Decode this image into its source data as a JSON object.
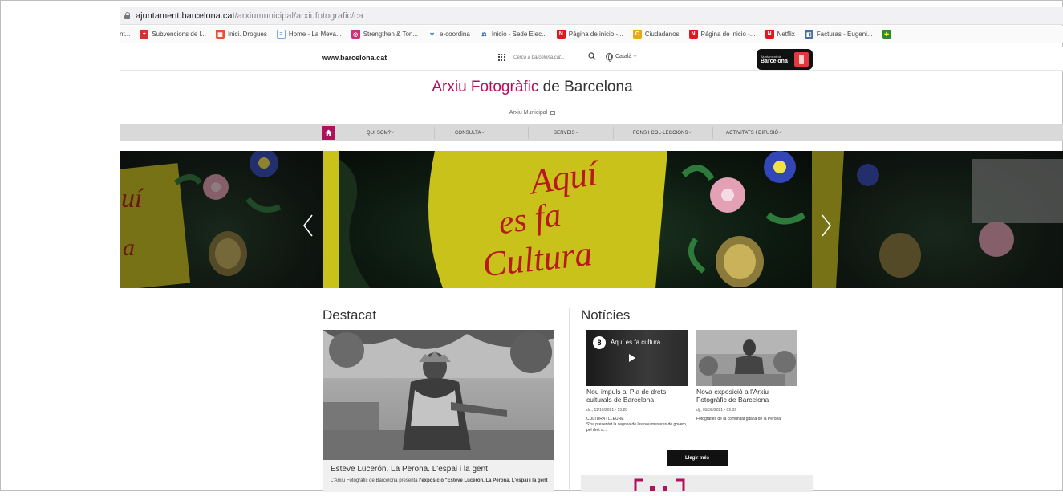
{
  "browser": {
    "url_host": "ajuntament.barcelona.cat",
    "url_path": "/arxiumunicipal/arxiufotografic/ca",
    "bookmarks": [
      {
        "label": "nt...",
        "color": ""
      },
      {
        "label": "Subvencions de l...",
        "color": "#d83030"
      },
      {
        "label": "Inici. Drogues",
        "color": "#e85030"
      },
      {
        "label": "Home - La Meva...",
        "color": "#7aa8d8"
      },
      {
        "label": "Strengthen & Ton...",
        "color": "#c8327a"
      },
      {
        "label": "e-coordina",
        "color": "#2e7bd0"
      },
      {
        "label": "Inicio - Sede Elec...",
        "color": "#1a5aa8"
      },
      {
        "label": "Página de inicio -...",
        "color": "#e0181e"
      },
      {
        "label": "Ciudadanos",
        "color": "#e6a817"
      },
      {
        "label": "Página de inicio -...",
        "color": "#e0181e"
      },
      {
        "label": "Netflix",
        "color": "#e0181e"
      },
      {
        "label": "Facturas - Eugeni...",
        "color": "#4a6fa5"
      }
    ]
  },
  "site": {
    "bcn_link": "www.barcelona.cat",
    "search_placeholder": "Cerca a barcelona.cat...",
    "language": "Català",
    "logo_small": "Ajuntament de",
    "logo_main": "Barcelona",
    "title_accent": "Arxiu Fotogràfic",
    "title_rest": " de Barcelona",
    "subtitle": "Arxiu Municipal"
  },
  "nav": {
    "items": [
      {
        "label": "QUI SOM?"
      },
      {
        "label": "CONSULTA"
      },
      {
        "label": "SERVEIS"
      },
      {
        "label": "FONS I COL·LECCIONS"
      },
      {
        "label": "ACTIVITATS I DIFUSIÓ"
      }
    ]
  },
  "hero": {
    "text_lines": [
      "Aquí",
      "es fa",
      "Cultura"
    ]
  },
  "destacat": {
    "title": "Destacat",
    "caption": "Esteve Lucerón. La Perona. L'espai i la gent",
    "text_prefix": "L'Arxiu Fotogràfic de Barcelona presenta ",
    "text_bold": "l'exposició \"Esteve Lucerón. La Perona. L'espai i la gent"
  },
  "noticies": {
    "title": "Notícies",
    "items": [
      {
        "video_title": "Aquí es fa cultura...",
        "title": "Nou impuls al Pla de drets culturals de Barcelona",
        "date": "dc., 11/10/2021 - 15:28",
        "category": "CULTURA I LLEURE",
        "summary": "S'ha presentat la segona de les nou mesures de govern, pel dret a..."
      },
      {
        "title": "Nova exposició a l'Arxiu Fotogràfic de Barcelona",
        "date": "dj., 09/30/2021 - 09:39",
        "category": "",
        "summary": "Fotografies de la comunitat gitana de la Perona"
      }
    ],
    "more_label": "Llegir més"
  },
  "colors": {
    "accent": "#b1105b",
    "nav_bg": "#d9d9d9",
    "hero_yellow": "#c9c21a",
    "hero_red": "#b8191e"
  }
}
